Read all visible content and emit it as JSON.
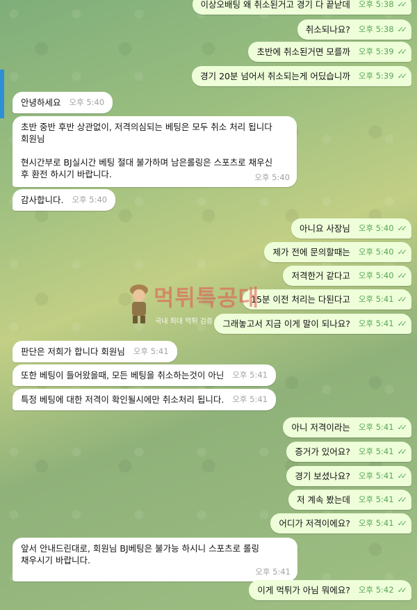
{
  "chat": {
    "messages": [
      {
        "dir": "out",
        "text": "이상오배팅 왜 취소된거고 경기 다 끝낟데",
        "time": "오후 5:38"
      },
      {
        "dir": "out",
        "text": "취소되나요?",
        "time": "오후 5:38"
      },
      {
        "dir": "out",
        "text": "초반에 취소된거면 모를까",
        "time": "오후 5:39"
      },
      {
        "dir": "out",
        "text": "경기  20분 넘어서 취소되는게 어딨습니까",
        "time": "오후 5:39"
      },
      {
        "dir": "in",
        "text": "안녕하세요",
        "time": "오후 5:40"
      },
      {
        "dir": "in",
        "lines": [
          "초반 중반 후반 상관없이, 저격의심되는 베팅은 모두 취소 처리 됩니다",
          "회원님",
          "",
          "현시간부로 BJ실시간 베팅 절대 불가하며 남은롤링은 스포츠로 채우신",
          "후 환전 하시기 바랍니다."
        ],
        "time": "오후 5:40"
      },
      {
        "dir": "in",
        "text": "감사합니다.",
        "time": "오후 5:40"
      },
      {
        "dir": "out",
        "text": "아니요 사장님",
        "time": "오후 5:40"
      },
      {
        "dir": "out",
        "text": "제가 전에 문의할때는",
        "time": "오후 5:40"
      },
      {
        "dir": "out",
        "text": "저격한거 같다고",
        "time": "오후 5:40"
      },
      {
        "dir": "out",
        "text": "15분 이전 처리는 다된다고",
        "time": "오후 5:41"
      },
      {
        "dir": "out",
        "text": "그래놓고서 지금 이게 말이 되나요?",
        "time": "오후 5:41"
      },
      {
        "dir": "in",
        "text": "판단은 저희가 합니다 회원님",
        "time": "오후 5:41"
      },
      {
        "dir": "in",
        "text": "또한 베팅이 들어왔을때, 모든 베팅을 취소하는것이 아닌",
        "time": "오후 5:41"
      },
      {
        "dir": "in",
        "text": "특정 베팅에 대한 저격이 확인될시에만 취소처리 됩니다.",
        "time": "오후 5:41"
      },
      {
        "dir": "out",
        "text": "아니 저격이라는",
        "time": "오후 5:41"
      },
      {
        "dir": "out",
        "text": "증거가 있어요?",
        "time": "오후 5:41"
      },
      {
        "dir": "out",
        "text": "경기 보셨나요?",
        "time": "오후 5:41"
      },
      {
        "dir": "out",
        "text": "저 계속 봤는데",
        "time": "오후 5:41"
      },
      {
        "dir": "out",
        "text": "어디가 저격이에요?",
        "time": "오후 5:41"
      },
      {
        "dir": "in",
        "lines": [
          "앞서 안내드린대로, 회원님 BJ베팅은 불가능 하시니 스포츠로 롤링",
          "채우시기 바랍니다."
        ],
        "time": "오후 5:41"
      },
      {
        "dir": "out",
        "text": "이게 먹튀가 아님 뭐에요?",
        "time": "오후 5:42"
      }
    ]
  },
  "watermark": {
    "title": "먹튀특공대",
    "subtitle": "국내 최대 먹튀 검증"
  },
  "colors": {
    "outgoing_bubble": "#eefed9",
    "incoming_bubble": "#ffffff",
    "outgoing_meta": "#58a657",
    "incoming_meta": "#a3a3a3"
  }
}
